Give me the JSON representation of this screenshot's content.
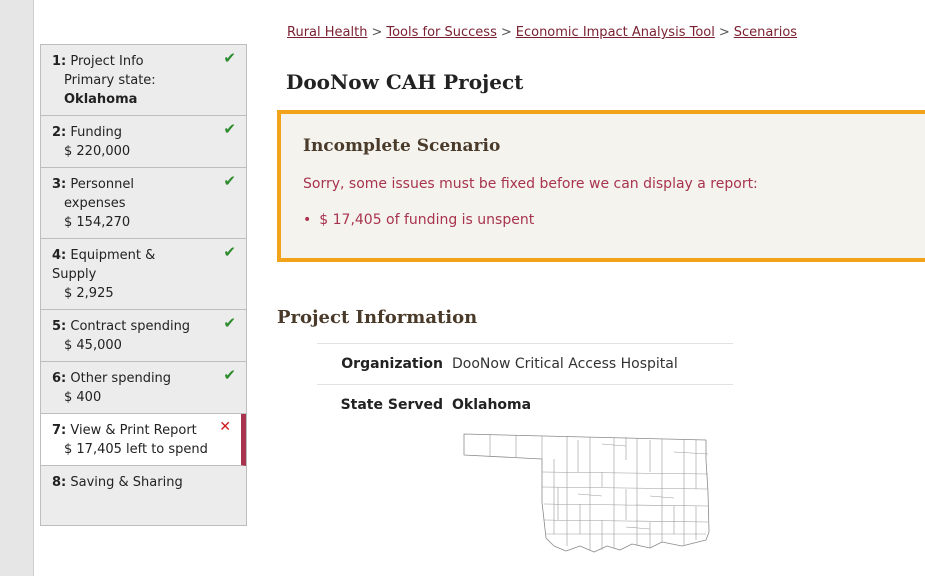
{
  "sidebar": {
    "steps": [
      {
        "num": "1:",
        "label": "Project Info",
        "sub": "Primary state:",
        "sub2": "Oklahoma",
        "status": "✔"
      },
      {
        "num": "2:",
        "label": "Funding",
        "sub": "$ 220,000",
        "status": "✔"
      },
      {
        "num": "3:",
        "label": "Personnel",
        "label2": "expenses",
        "sub": "$ 154,270",
        "status": "✔"
      },
      {
        "num": "4:",
        "label": "Equipment &",
        "label2": "Supply",
        "sub": "$ 2,925",
        "status": "✔"
      },
      {
        "num": "5:",
        "label": "Contract spending",
        "sub": "$ 45,000",
        "status": "✔"
      },
      {
        "num": "6:",
        "label": "Other spending",
        "sub": "$ 400",
        "status": "✔"
      },
      {
        "num": "7:",
        "label": "View & Print Report",
        "sub": "$ 17,405 left to spend",
        "status": "✕"
      },
      {
        "num": "8:",
        "label": "Saving & Sharing"
      }
    ]
  },
  "breadcrumb": {
    "items": [
      "Rural Health",
      "Tools for Success",
      "Economic Impact Analysis Tool",
      "Scenarios"
    ],
    "separator": ">"
  },
  "page": {
    "title": "DooNow CAH Project"
  },
  "alert": {
    "title": "Incomplete Scenario",
    "message": "Sorry, some issues must be fixed before we can display a report:",
    "issues": [
      "$ 17,405 of funding is unspent"
    ],
    "bullet": "•"
  },
  "project_info": {
    "title": "Project Information",
    "rows": [
      {
        "label": "Organization",
        "value": "DooNow Critical Access Hospital"
      },
      {
        "label": "State Served",
        "value": "Oklahoma"
      }
    ]
  },
  "colors": {
    "accent": "#a8334e",
    "alert_border": "#f3a31a",
    "check": "#2e8b2e",
    "error": "#cc1a1a"
  }
}
